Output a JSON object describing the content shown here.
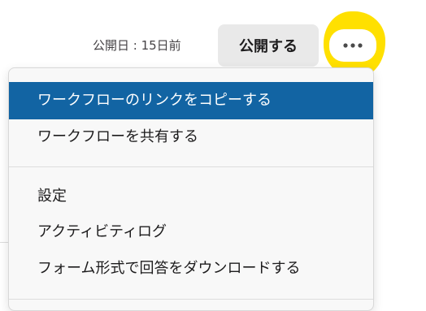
{
  "header": {
    "published_label": "公開日 : 15日前",
    "publish_button_label": "公開する",
    "more_button_icon": "ellipsis-icon"
  },
  "colors": {
    "highlight": "#ffe000",
    "active_item_bg": "#1264a3",
    "publish_button_bg": "#e9e9e9",
    "menu_bg": "#f8f8f8"
  },
  "menu": {
    "items": [
      {
        "label": "ワークフローのリンクをコピーする",
        "state": "highlighted"
      },
      {
        "label": "ワークフローを共有する"
      },
      {
        "label": "設定"
      },
      {
        "label": "アクティビティログ"
      },
      {
        "label": "フォーム形式で回答をダウンロードする"
      }
    ]
  }
}
